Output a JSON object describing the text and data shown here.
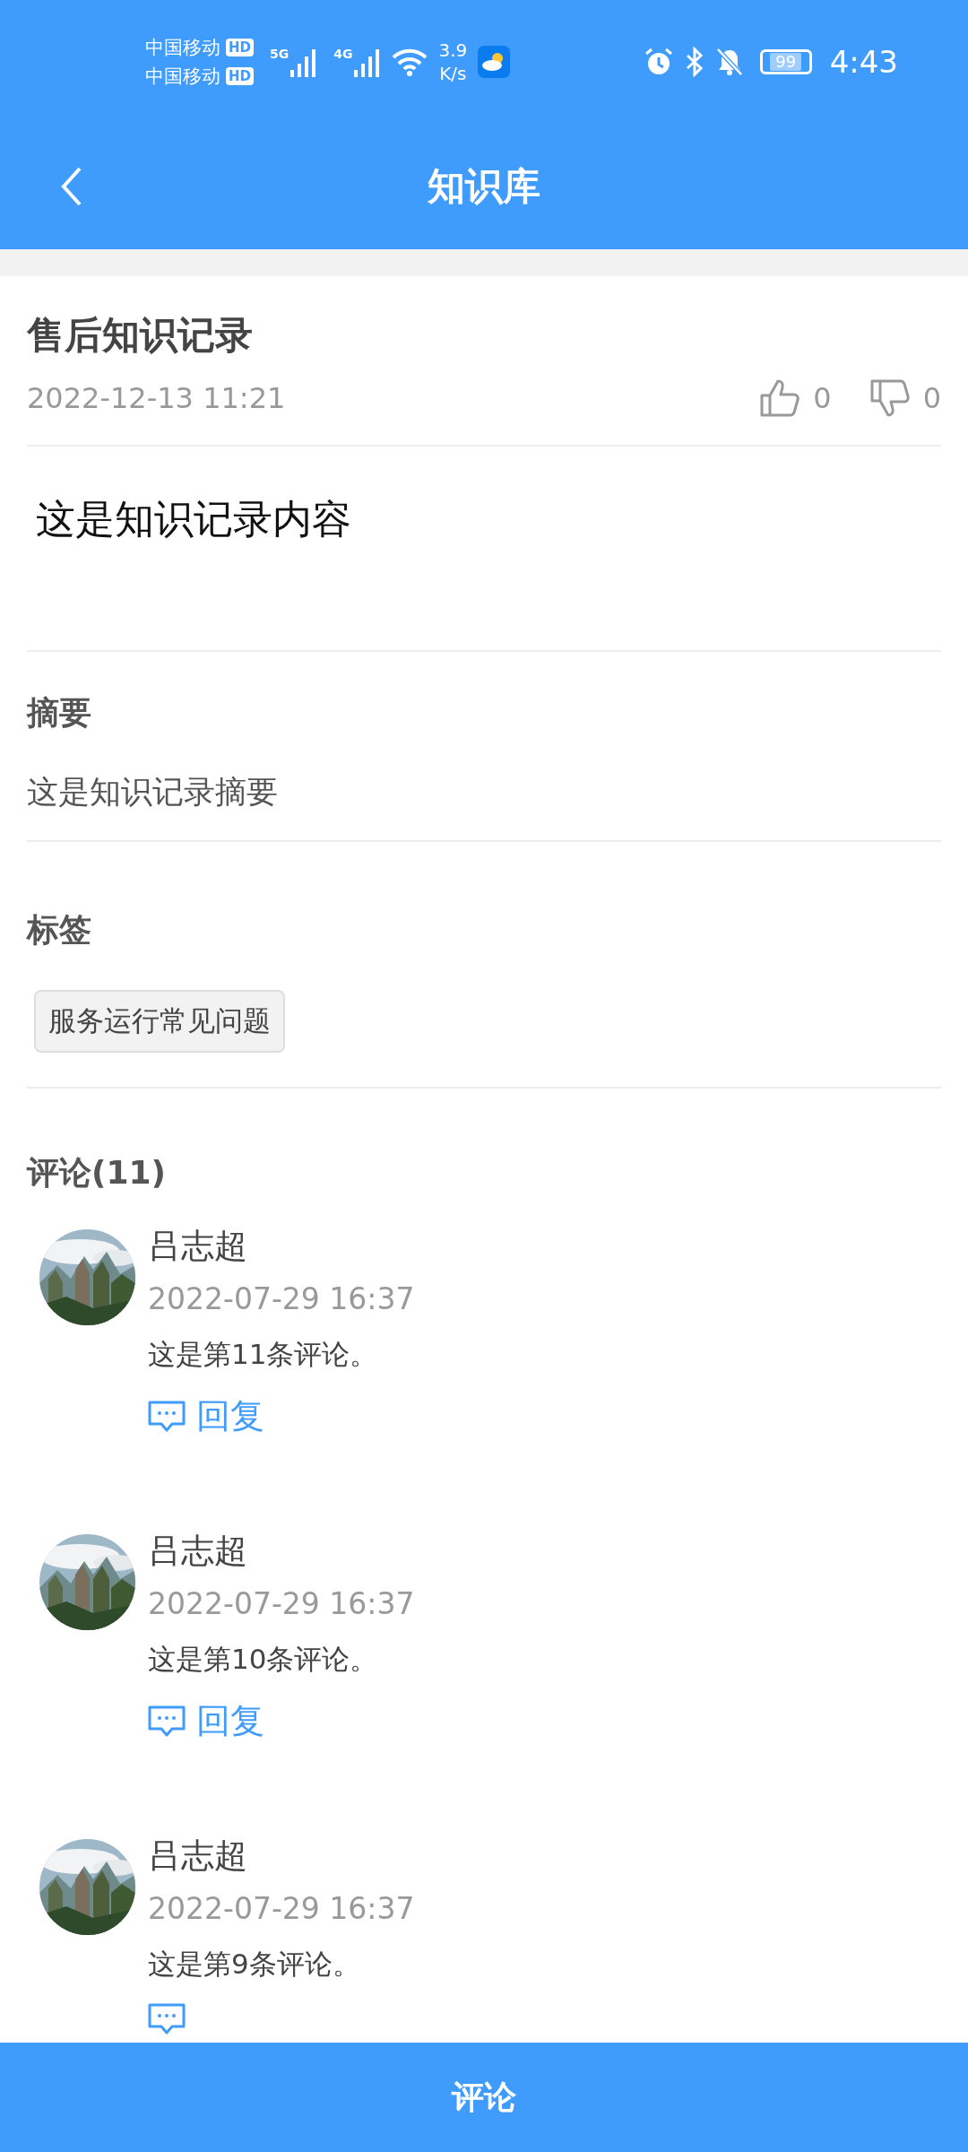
{
  "status_bar": {
    "carriers": [
      {
        "name": "中国移动",
        "badge": "HD"
      },
      {
        "name": "中国移动",
        "badge": "HD"
      }
    ],
    "network_labels": [
      "5G",
      "4G"
    ],
    "speed_value": "3.9",
    "speed_unit": "K/s",
    "battery": "99",
    "time": "4:43"
  },
  "header": {
    "title": "知识库"
  },
  "article": {
    "title": "售后知识记录",
    "date": "2022-12-13 11:21",
    "likes": "0",
    "dislikes": "0",
    "content": "这是知识记录内容"
  },
  "summary": {
    "heading": "摘要",
    "text": "这是知识记录摘要"
  },
  "tags": {
    "heading": "标签",
    "items": [
      "服务运行常见问题"
    ]
  },
  "comments": {
    "heading": "评论(11)",
    "items": [
      {
        "author": "吕志超",
        "date": "2022-07-29 16:37",
        "text": "这是第11条评论。",
        "reply_label": "回复"
      },
      {
        "author": "吕志超",
        "date": "2022-07-29 16:37",
        "text": "这是第10条评论。",
        "reply_label": "回复"
      },
      {
        "author": "吕志超",
        "date": "2022-07-29 16:37",
        "text": "这是第9条评论。"
      }
    ]
  },
  "bottom_button": "评论"
}
